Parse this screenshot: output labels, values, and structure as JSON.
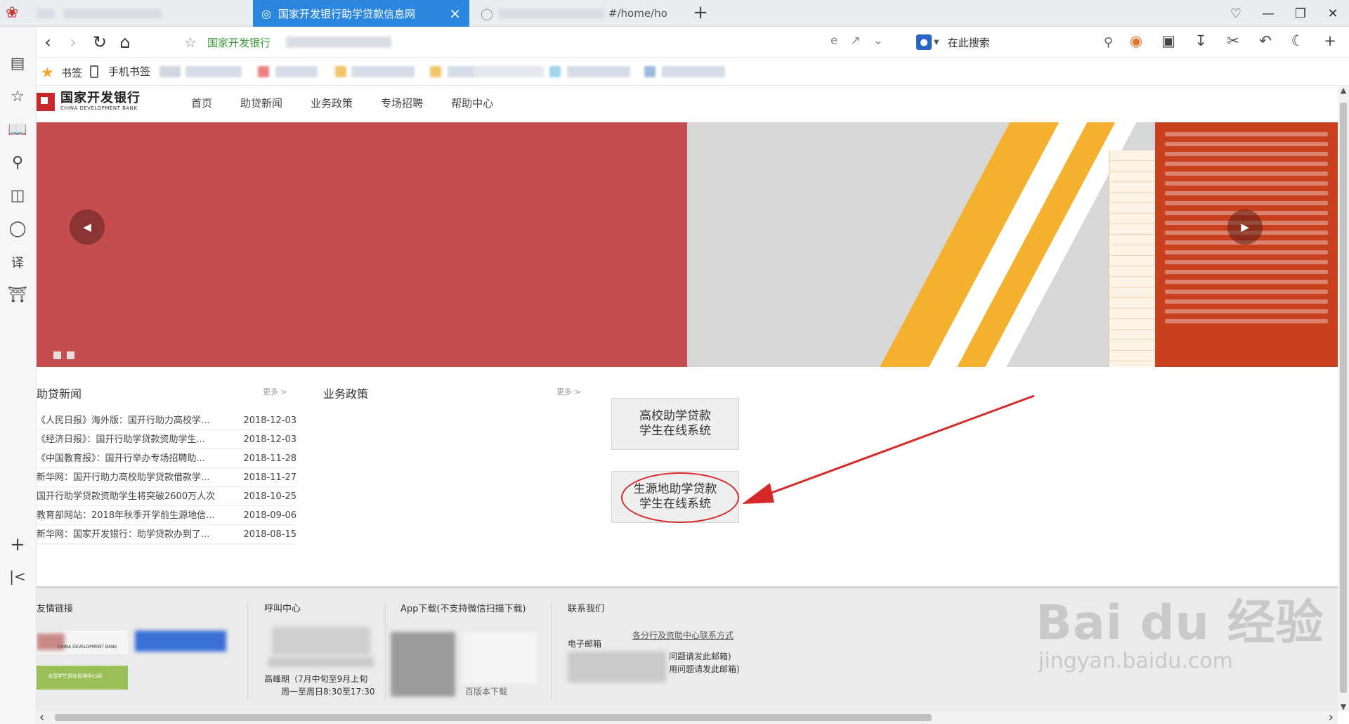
{
  "browser": {
    "tabs": [
      {
        "label": "",
        "state": "blurred"
      },
      {
        "label": "国家开发银行助学贷款信息网",
        "state": "active"
      },
      {
        "label": "#/home/ho",
        "state": "blurred"
      }
    ],
    "address_label": "国家开发银行",
    "search_placeholder": "在此搜索",
    "bookmarks": {
      "bookmark_label": "书签",
      "mobile_label": "手机书签"
    }
  },
  "site": {
    "logo_cn": "国家开发银行",
    "logo_en": "CHINA DEVELOPMENT BANK",
    "nav": [
      "首页",
      "助贷新闻",
      "业务政策",
      "专场招聘",
      "帮助中心"
    ]
  },
  "news": {
    "title": "助贷新闻",
    "more": "更多 >",
    "items": [
      {
        "title": "《人民日报》海外版：国开行助力高校学...",
        "date": "2018-12-03"
      },
      {
        "title": "《经济日报》：国开行助学贷款资助学生...",
        "date": "2018-12-03"
      },
      {
        "title": "《中国教育报》：国开行举办专场招聘助...",
        "date": "2018-11-28"
      },
      {
        "title": "新华网：国开行助力高校助学贷款借款学...",
        "date": "2018-11-27"
      },
      {
        "title": "国开行助学贷款资助学生将突破2600万人次",
        "date": "2018-10-25"
      },
      {
        "title": "教育部网站：2018年秋季开学前生源地信...",
        "date": "2018-09-06"
      },
      {
        "title": "新华网：国家开发银行：助学贷款办到了...",
        "date": "2018-08-15"
      }
    ]
  },
  "policy": {
    "title": "业务政策",
    "more": "更多 >"
  },
  "systems": {
    "campus": {
      "line1": "高校助学贷款",
      "line2": "学生在线系统"
    },
    "origin": {
      "line1": "生源地助学贷款",
      "line2": "学生在线系统"
    }
  },
  "footer": {
    "links_title": "友情链接",
    "callcenter_title": "呼叫中心",
    "callcenter_peak": "高峰期（7月中旬至9月上旬",
    "callcenter_hours": "周一至周日8:30至17:30",
    "app_title": "App下载(不支持微信扫描下载)",
    "contact_title": "联系我们",
    "contact_link": "各分行及资助中心联系方式",
    "email_label": "电子邮箱",
    "contact_line1": "问题请发此邮箱)",
    "contact_line2": "用问题请发此邮箱)",
    "app_note": "百版本下载",
    "logo1_text": "CHINA DEVELOPMENT BANK",
    "logo2_text": "全国学生资助管理中心网"
  },
  "watermark": {
    "main": "Bai du 经验",
    "sub": "jingyan.baidu.com"
  },
  "colors": {
    "tab_active": "#2b86e0",
    "banner_red": "#c64d4e",
    "brand_red": "#c8282b",
    "annotation_red": "#d42a2a"
  }
}
